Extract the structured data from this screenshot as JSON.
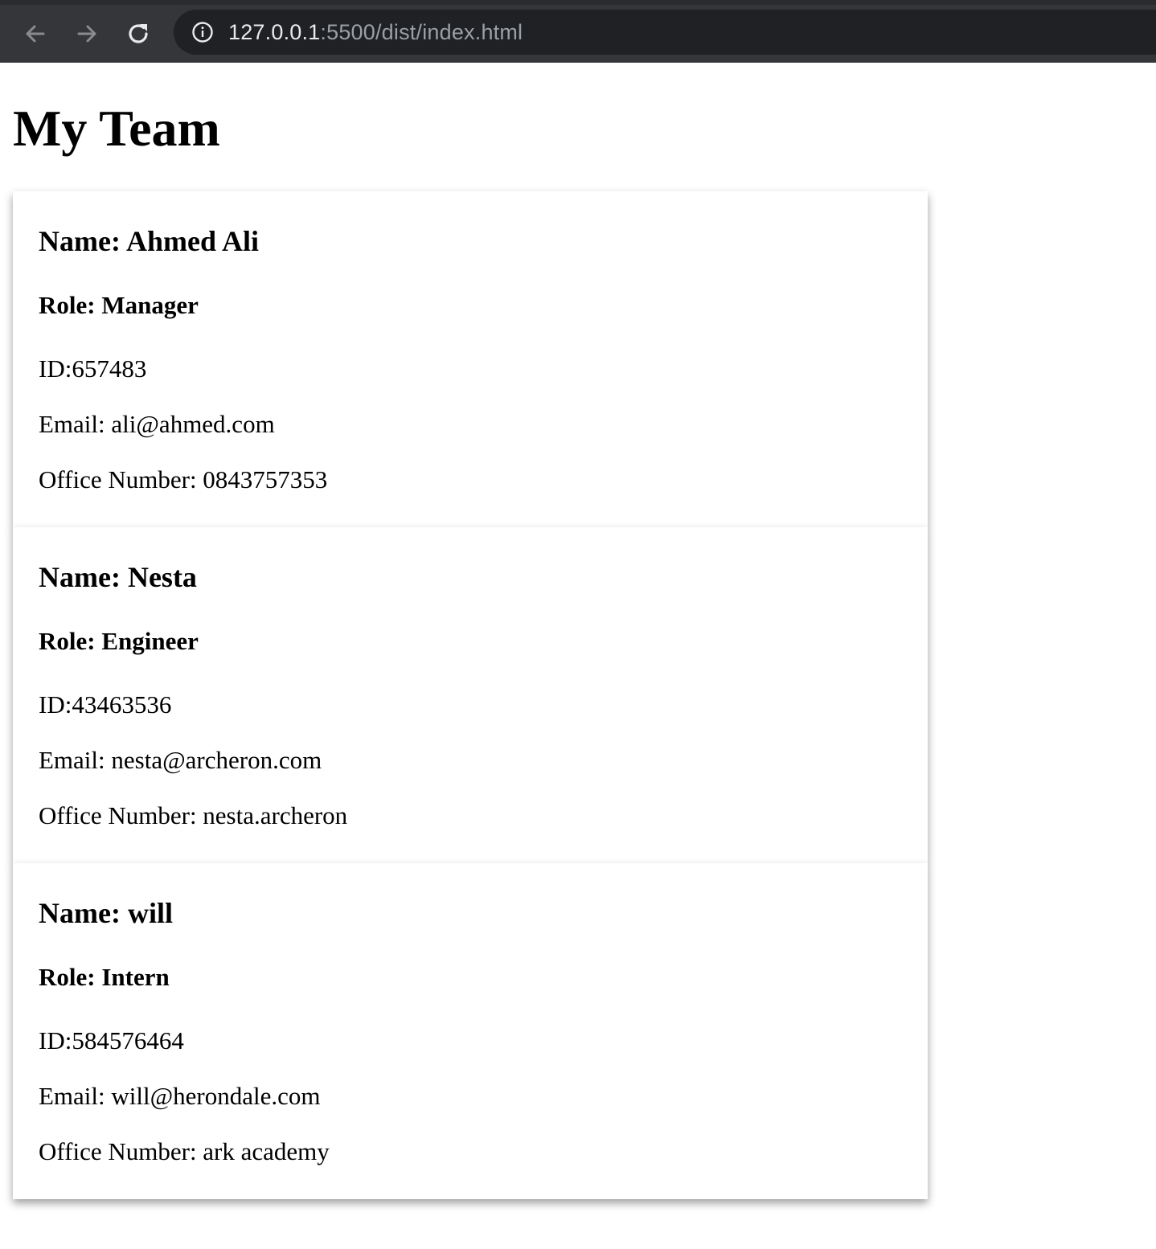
{
  "browser": {
    "url_host": "127.0.0.1",
    "url_path": ":5500/dist/index.html"
  },
  "page": {
    "title": "My Team"
  },
  "team": [
    {
      "name": "Name: Ahmed Ali",
      "role": "Role: Manager",
      "id": "ID:657483",
      "email": "Email: ali@ahmed.com",
      "extra": "Office Number: 0843757353"
    },
    {
      "name": "Name: Nesta",
      "role": "Role: Engineer",
      "id": "ID:43463536",
      "email": "Email: nesta@archeron.com",
      "extra": "Office Number: nesta.archeron"
    },
    {
      "name": "Name: will",
      "role": "Role: Intern",
      "id": "ID:584576464",
      "email": "Email: will@herondale.com",
      "extra": "Office Number: ark academy"
    }
  ]
}
